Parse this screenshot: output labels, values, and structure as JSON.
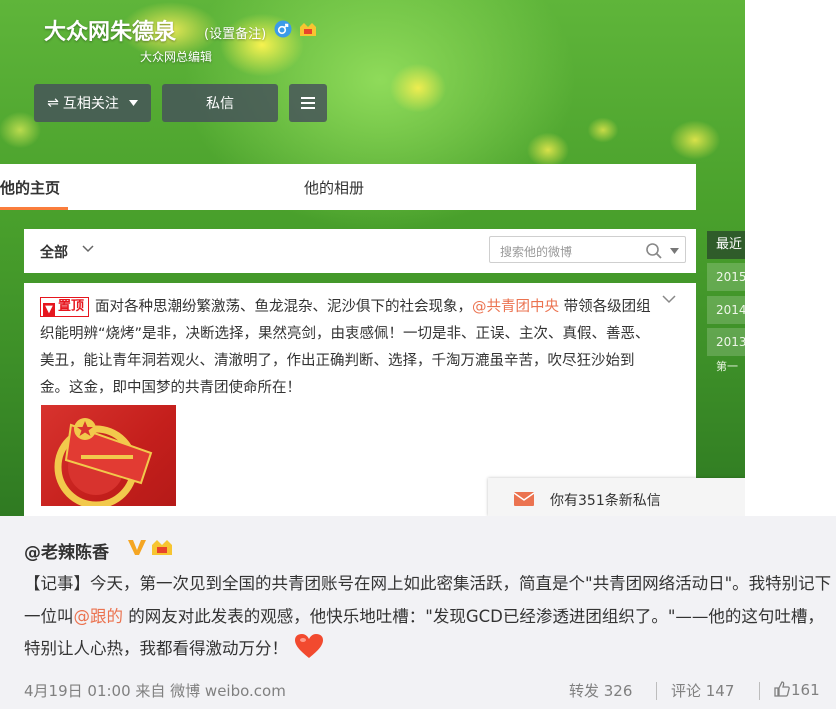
{
  "profile": {
    "name": "大众网朱德泉",
    "remark_link": "(设置备注)",
    "subtitle": "大众网总编辑",
    "follow_label": "互相关注",
    "message_label": "私信"
  },
  "tabs": [
    {
      "label": "他的主页"
    },
    {
      "label": "他的相册"
    }
  ],
  "filter": {
    "label": "全部",
    "search_placeholder": "搜索他的微博"
  },
  "pinned_post": {
    "pin_label": "置顶",
    "text_before": "面对各种思潮纷繁激荡、鱼龙混杂、泥沙俱下的社会现象，",
    "mention": "@共青团中央",
    "text_after": " 带领各级团组织能明辨“烧烤”是非，决断选择，果然亮剑，由衷感佩！一切是非、正误、主次、真假、善恶、美丑，能让青年洞若观火、清澈明了，作出正确判断、选择，千淘万漉虽辛苦，吹尽狂沙始到金。这金，即中国梦的共青团使命所在！"
  },
  "timeline": {
    "label": "最近",
    "years": [
      "2015",
      "2014",
      "2013"
    ],
    "first": "第一"
  },
  "notification": {
    "text": "你有351条新私信"
  },
  "comment": {
    "author": "@老辣陈香",
    "text_1": "【记事】今天，第一次见到全国的共青团账号在网上如此密集活跃，简直是个\"共青团网络活动日\"。我特别记下一位叫",
    "link": "@跟的",
    "text_2": " 的网友对此发表的观感，他快乐地吐槽：\"发现GCD已经渗透进团组织了。\"——他的这句吐槽，特别让人心热，我都看得激动万分！",
    "meta": "4月19日 01:00 来自 微博 weibo.com",
    "repost": "转发 326",
    "comment_count": "评论 147",
    "likes": "161"
  },
  "colors": {
    "accent_orange": "#fa7d3c",
    "mention": "#eb7350",
    "pin_red": "#e6161e"
  }
}
